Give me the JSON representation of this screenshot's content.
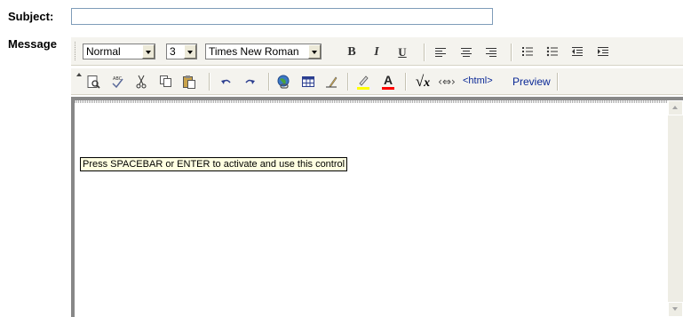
{
  "form": {
    "subject_label": "Subject:",
    "subject_value": "",
    "message_label": "Message"
  },
  "toolbar1": {
    "format_value": "Normal",
    "size_value": "3",
    "font_value": "Times New Roman",
    "bold_label": "B",
    "italic_label": "I",
    "underline_label": "U",
    "align_left_icon": "align-left-icon",
    "align_center_icon": "align-center-icon",
    "align_right_icon": "align-right-icon",
    "ordered_list_icon": "ordered-list-icon",
    "unordered_list_icon": "unordered-list-icon",
    "outdent_icon": "outdent-icon",
    "indent_icon": "indent-icon"
  },
  "toolbar2": {
    "html_label": "<html>",
    "preview_label": "Preview",
    "highlight_color": "#ffff00",
    "font_color": "#ff0000"
  },
  "tooltip": {
    "text": "Press SPACEBAR or ENTER to activate and use this control"
  },
  "colors": {
    "toolbar_bg": "#f4f3ee",
    "link_text": "#0a2896",
    "tooltip_bg": "#ffffe1"
  }
}
